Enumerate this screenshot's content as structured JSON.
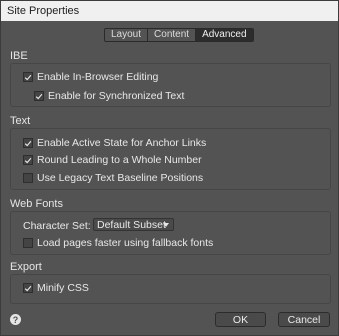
{
  "window": {
    "title": "Site Properties"
  },
  "tabs": [
    {
      "label": "Layout",
      "active": false
    },
    {
      "label": "Content",
      "active": false
    },
    {
      "label": "Advanced",
      "active": true
    }
  ],
  "sections": {
    "ibe": {
      "title": "IBE",
      "options": [
        {
          "label": "Enable In-Browser Editing",
          "checked": true
        },
        {
          "label": "Enable for Synchronized Text",
          "checked": true
        }
      ]
    },
    "text": {
      "title": "Text",
      "options": [
        {
          "label": "Enable Active State for Anchor Links",
          "checked": true
        },
        {
          "label": "Round Leading to a Whole Number",
          "checked": true
        },
        {
          "label": "Use Legacy Text Baseline Positions",
          "checked": false
        }
      ]
    },
    "webfonts": {
      "title": "Web Fonts",
      "charset_label": "Character Set:",
      "charset_value": "Default Subset",
      "options": [
        {
          "label": "Load pages faster using fallback fonts",
          "checked": false
        }
      ]
    },
    "export": {
      "title": "Export",
      "options": [
        {
          "label": "Minify CSS",
          "checked": true
        }
      ]
    }
  },
  "footer": {
    "help_glyph": "?",
    "ok_label": "OK",
    "cancel_label": "Cancel"
  },
  "colors": {
    "background": "#535353",
    "titlebar": "#f0f0f0",
    "active_tab": "#2c2c2c"
  }
}
